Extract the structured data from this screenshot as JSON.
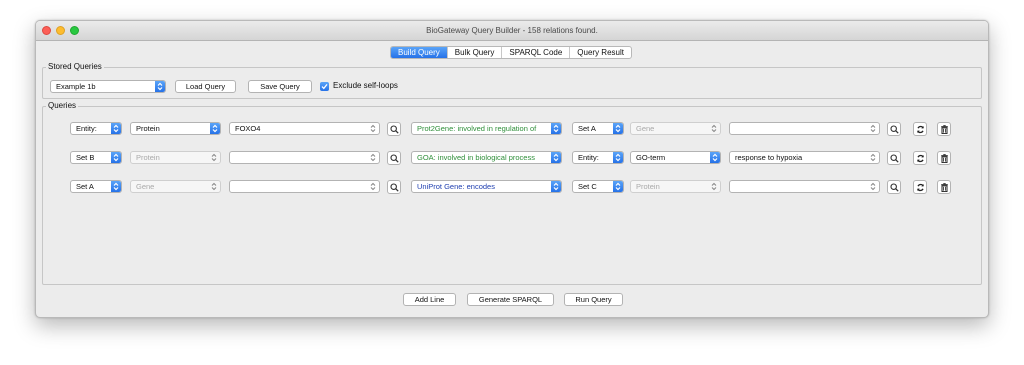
{
  "window": {
    "title": "BioGateway Query Builder - 158 relations found."
  },
  "tabs": [
    "Build Query",
    "Bulk Query",
    "SPARQL Code",
    "Query Result"
  ],
  "stored": {
    "label": "Stored Queries",
    "selected": "Example 1b",
    "load_label": "Load Query",
    "save_label": "Save Query",
    "exclude_label": "Exclude self-loops",
    "exclude_checked": true
  },
  "queries": {
    "label": "Queries",
    "rows": [
      {
        "type": "Entity:",
        "class": "Protein",
        "value": "FOXO4",
        "relation": "Prot2Gene: involved in regulation of",
        "type2": "Set A",
        "class2": "Gene",
        "value2": ""
      },
      {
        "type": "Set B",
        "class": "Protein",
        "value": "",
        "relation": "GOA: involved in biological process",
        "type2": "Entity:",
        "class2": "GO-term",
        "value2": "response to hypoxia"
      },
      {
        "type": "Set A",
        "class": "Gene",
        "value": "",
        "relation": "UniProt Gene: encodes",
        "type2": "Set C",
        "class2": "Protein",
        "value2": ""
      }
    ]
  },
  "footer": {
    "add_line": "Add Line",
    "generate": "Generate SPARQL",
    "run": "Run Query"
  },
  "colors": {
    "accent": "#2672e8",
    "relation_green": "#2f8f3a",
    "relation_blue": "#1f3fb0"
  }
}
